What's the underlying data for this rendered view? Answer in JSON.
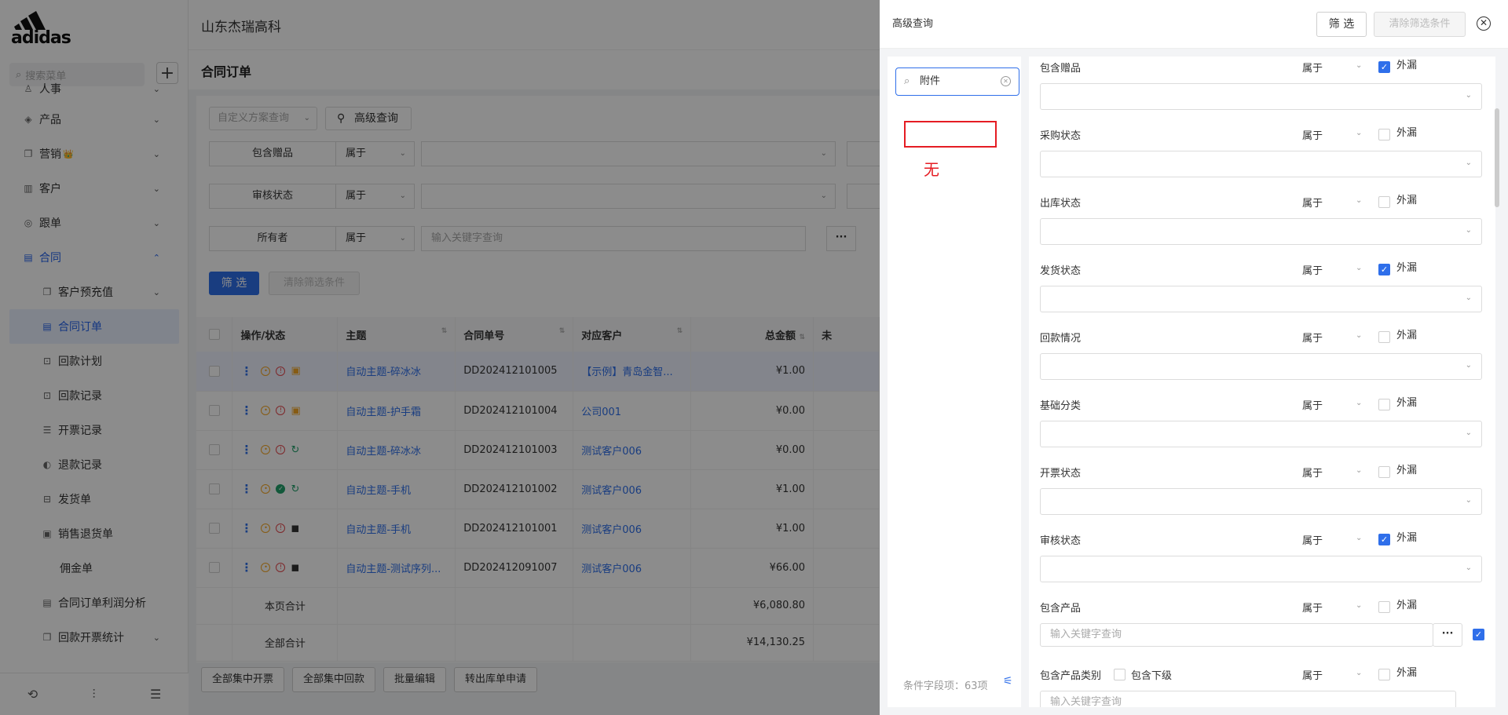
{
  "logo": {
    "text": "adidas"
  },
  "sidebar": {
    "search_placeholder": "搜索菜单",
    "items": [
      {
        "label": "人事",
        "icon": "people-icon"
      },
      {
        "label": "产品",
        "icon": "cube-icon"
      },
      {
        "label": "营销",
        "icon": "copy-icon",
        "badge": "👑"
      },
      {
        "label": "客户",
        "icon": "chart-icon"
      },
      {
        "label": "跟单",
        "icon": "target-icon"
      },
      {
        "label": "合同",
        "icon": "doc-icon"
      }
    ],
    "sub_items": [
      {
        "label": "客户预充值"
      },
      {
        "label": "合同订单"
      },
      {
        "label": "回款计划"
      },
      {
        "label": "回款记录"
      },
      {
        "label": "开票记录"
      },
      {
        "label": "退款记录"
      },
      {
        "label": "发货单"
      },
      {
        "label": "销售退货单"
      },
      {
        "label": "佣金单"
      },
      {
        "label": "合同订单利润分析"
      },
      {
        "label": "回款开票统计"
      }
    ]
  },
  "header": {
    "company": "山东杰瑞高科"
  },
  "page": {
    "title": "合同订单",
    "scheme_placeholder": "自定义方案查询",
    "advanced_label": "高级查询",
    "filters": [
      {
        "name": "包含赠品",
        "op": "属于"
      },
      {
        "name": "审核状态",
        "op": "属于"
      },
      {
        "name": "所有者",
        "op": "属于",
        "placeholder": "输入关键字查询"
      }
    ],
    "filter_btn": "筛 选",
    "clear_btn": "清除筛选条件",
    "table": {
      "headers": [
        "操作/状态",
        "主题",
        "合同单号",
        "对应客户",
        "总金额",
        "未"
      ],
      "rows": [
        {
          "subject": "自动主题-碎冰冰",
          "no": "DD202412101005",
          "customer": "【示例】青岛金智...",
          "amount": "¥1.00"
        },
        {
          "subject": "自动主题-护手霜",
          "no": "DD202412101004",
          "customer": "公司001",
          "amount": "¥0.00"
        },
        {
          "subject": "自动主题-碎冰冰",
          "no": "DD202412101003",
          "customer": "测试客户006",
          "amount": "¥0.00"
        },
        {
          "subject": "自动主题-手机",
          "no": "DD202412101002",
          "customer": "测试客户006",
          "amount": "¥1.00"
        },
        {
          "subject": "自动主题-手机",
          "no": "DD202412101001",
          "customer": "测试客户006",
          "amount": "¥1.00"
        },
        {
          "subject": "自动主题-测试序列...",
          "no": "DD202412091007",
          "customer": "测试客户006",
          "amount": "¥66.00"
        }
      ],
      "page_total_label": "本页合计",
      "page_total": "¥6,080.80",
      "all_total_label": "全部合计",
      "all_total": "¥14,130.25"
    },
    "bottom_buttons": [
      "全部集中开票",
      "全部集中回款",
      "批量编辑",
      "转出库单申请"
    ]
  },
  "drawer": {
    "title": "高级查询",
    "filter_btn": "筛 选",
    "clear_btn": "清除筛选条件",
    "search_value": "附件",
    "none_text": "无",
    "field_count": "条件字段项：63项",
    "conditions": [
      {
        "name": "包含赠品",
        "op": "属于",
        "label": "外漏",
        "checked": true
      },
      {
        "name": "采购状态",
        "op": "属于",
        "label": "外漏",
        "checked": false
      },
      {
        "name": "出库状态",
        "op": "属于",
        "label": "外漏",
        "checked": false
      },
      {
        "name": "发货状态",
        "op": "属于",
        "label": "外漏",
        "checked": true
      },
      {
        "name": "回款情况",
        "op": "属于",
        "label": "外漏",
        "checked": false
      },
      {
        "name": "基础分类",
        "op": "属于",
        "label": "外漏",
        "checked": false
      },
      {
        "name": "开票状态",
        "op": "属于",
        "label": "外漏",
        "checked": false
      },
      {
        "name": "审核状态",
        "op": "属于",
        "label": "外漏",
        "checked": true
      },
      {
        "name": "包含产品",
        "op": "属于",
        "label": "外漏",
        "checked": false,
        "placeholder": "输入关键字查询"
      },
      {
        "name": "包含产品类别",
        "op": "属于",
        "label": "外漏",
        "checked": false,
        "sub_label": "包含下级",
        "placeholder": "输入关键字查询"
      }
    ]
  }
}
